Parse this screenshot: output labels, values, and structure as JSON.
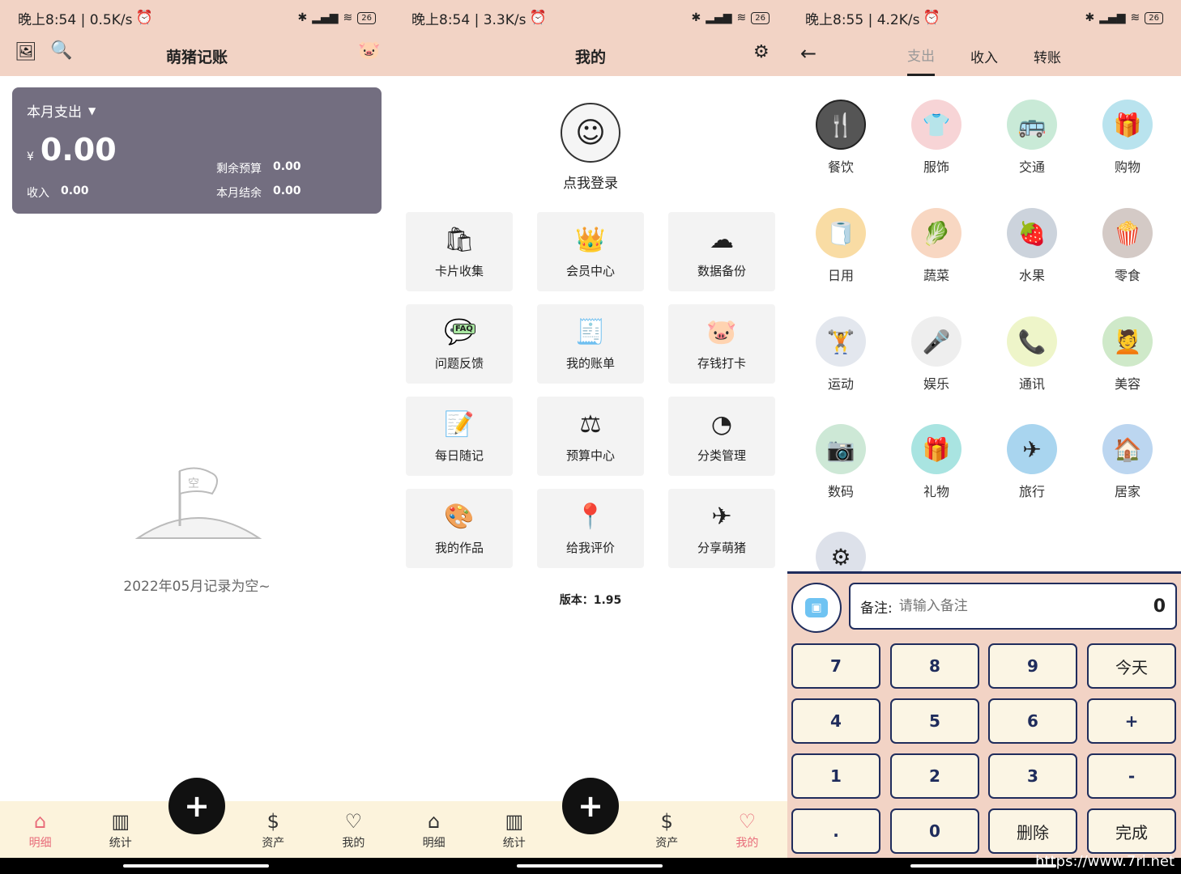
{
  "screen1": {
    "status": {
      "time": "晚上8:54 | 0.5K/s",
      "battery": "26"
    },
    "title": "萌猪记账",
    "card": {
      "period_label": "本月支出",
      "currency": "¥",
      "amount": "0.00",
      "remaining_budget_label": "剩余预算",
      "remaining_budget_value": "0.00",
      "income_label": "收入",
      "income_value": "0.00",
      "balance_label": "本月结余",
      "balance_value": "0.00"
    },
    "empty_flag_text": "空",
    "empty_text": "2022年05月记录为空~",
    "tabs": [
      "明细",
      "统计",
      "资产",
      "我的"
    ],
    "fab": "+"
  },
  "screen2": {
    "status": {
      "time": "晚上8:54 | 3.3K/s",
      "battery": "26"
    },
    "title": "我的",
    "login": "点我登录",
    "tiles": [
      {
        "label": "卡片收集",
        "icon": "🛍"
      },
      {
        "label": "会员中心",
        "icon": "👑"
      },
      {
        "label": "数据备份",
        "icon": "☁"
      },
      {
        "label": "问题反馈",
        "icon": "💬"
      },
      {
        "label": "我的账单",
        "icon": "🧾"
      },
      {
        "label": "存钱打卡",
        "icon": "🐷"
      },
      {
        "label": "每日随记",
        "icon": "📝"
      },
      {
        "label": "预算中心",
        "icon": "⚖"
      },
      {
        "label": "分类管理",
        "icon": "◔"
      },
      {
        "label": "我的作品",
        "icon": "🎨"
      },
      {
        "label": "给我评价",
        "icon": "📍"
      },
      {
        "label": "分享萌猪",
        "icon": "✈"
      }
    ],
    "faq_badge": "FAQ",
    "version": "版本：1.95",
    "tabs": [
      "明细",
      "统计",
      "资产",
      "我的"
    ],
    "fab": "+"
  },
  "screen3": {
    "status": {
      "time": "晚上8:55 | 4.2K/s",
      "battery": "26"
    },
    "tabs": [
      "支出",
      "收入",
      "转账"
    ],
    "categories": [
      {
        "label": "餐饮",
        "icon": "🍴",
        "color": "#555555"
      },
      {
        "label": "服饰",
        "icon": "👕",
        "color": "#f7d4d6"
      },
      {
        "label": "交通",
        "icon": "🚌",
        "color": "#c9ead7"
      },
      {
        "label": "购物",
        "icon": "🎁",
        "color": "#b9e3ee"
      },
      {
        "label": "日用",
        "icon": "🧻",
        "color": "#f9dca4"
      },
      {
        "label": "蔬菜",
        "icon": "🥬",
        "color": "#f8d7c2"
      },
      {
        "label": "水果",
        "icon": "🍓",
        "color": "#ccd3dc"
      },
      {
        "label": "零食",
        "icon": "🍿",
        "color": "#d4cac6"
      },
      {
        "label": "运动",
        "icon": "🏋",
        "color": "#e3e7ee"
      },
      {
        "label": "娱乐",
        "icon": "🎤",
        "color": "#eeeeee"
      },
      {
        "label": "通讯",
        "icon": "📞",
        "color": "#eef5c9"
      },
      {
        "label": "美容",
        "icon": "💆",
        "color": "#cfe9c9"
      },
      {
        "label": "数码",
        "icon": "📷",
        "color": "#cde8d6"
      },
      {
        "label": "礼物",
        "icon": "🎁",
        "color": "#a9e4e1"
      },
      {
        "label": "旅行",
        "icon": "✈",
        "color": "#a9d5ef"
      },
      {
        "label": "居家",
        "icon": "🏠",
        "color": "#bcd6f0"
      },
      {
        "label": "",
        "icon": "⚙",
        "color": "#dde1ea"
      }
    ],
    "note_label": "备注:",
    "note_placeholder": "请输入备注",
    "amount": "0",
    "keys": [
      "7",
      "8",
      "9",
      "今天",
      "4",
      "5",
      "6",
      "+",
      "1",
      "2",
      "3",
      "-",
      ".",
      "0",
      "删除",
      "完成"
    ]
  },
  "watermark": "https://www.7ri.net"
}
